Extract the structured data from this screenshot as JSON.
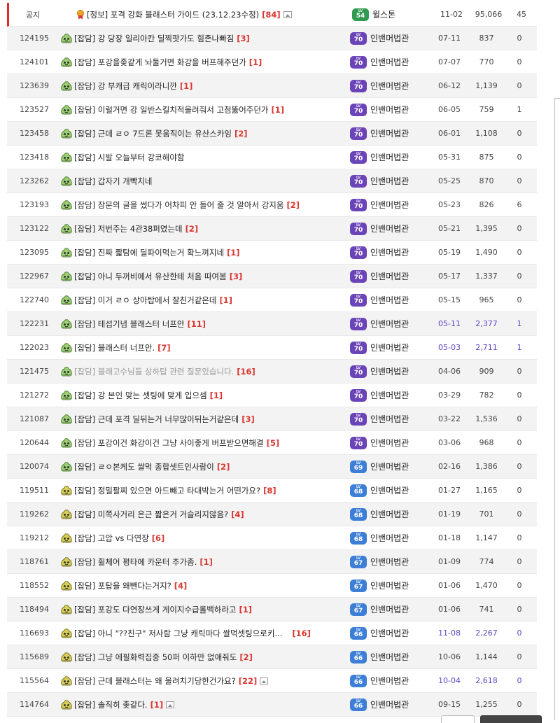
{
  "notice": {
    "label": "공지",
    "title": "[정보] 포격 강화 블래스터 가이드 (23.12.23수정)",
    "comments": "[84]",
    "has_image": true,
    "writer_level": "54",
    "writer": "윌스톤",
    "date": "11-02",
    "views": "95,066",
    "recommends": "45"
  },
  "rows": [
    {
      "num": "124195",
      "title": "[잡담] 강 당장 일리아칸 딜찍팟가도 힘존나빠짐",
      "comments": "[3]",
      "level": "70",
      "rank": "green",
      "writer": "인밴머법관",
      "date": "07-11",
      "views": "837",
      "rec": "0"
    },
    {
      "num": "124101",
      "title": "[잡담] 포강을좆같게 놔둘거면 화강을 버프해주던가",
      "comments": "[1]",
      "level": "70",
      "rank": "green",
      "writer": "인밴머법관",
      "date": "07-07",
      "views": "770",
      "rec": "0"
    },
    {
      "num": "123639",
      "title": "[잡담] 강 부캐급 캐릭이라니깐",
      "comments": "[1]",
      "level": "70",
      "rank": "green",
      "writer": "인밴머법관",
      "date": "06-12",
      "views": "1,139",
      "rec": "0"
    },
    {
      "num": "123527",
      "title": "[잡담] 이럴거면 강 일반스킬치적올려줘서 고점뚫어주던가",
      "comments": "[1]",
      "level": "70",
      "rank": "green",
      "writer": "인밴머법관",
      "date": "06-05",
      "views": "759",
      "rec": "1"
    },
    {
      "num": "123458",
      "title": "[잡담] 근데 ㄹㅇ 7드론 못움직이는 유산스카잉",
      "comments": "[2]",
      "level": "70",
      "rank": "green",
      "writer": "인밴머법관",
      "date": "06-01",
      "views": "1,108",
      "rec": "0"
    },
    {
      "num": "123418",
      "title": "[잡담] 시발 오늘부터 강코해야함",
      "comments": "",
      "level": "70",
      "rank": "green",
      "writer": "인밴머법관",
      "date": "05-31",
      "views": "875",
      "rec": "0"
    },
    {
      "num": "123262",
      "title": "[잡담] 갑자기 개빡치네",
      "comments": "",
      "level": "70",
      "rank": "green",
      "writer": "인밴머법관",
      "date": "05-25",
      "views": "870",
      "rec": "0"
    },
    {
      "num": "123193",
      "title": "[잡담] 장문의 글을 썼다가 어차피 안 들어 줄 것 알아서 강지움",
      "comments": "[2]",
      "level": "70",
      "rank": "green",
      "writer": "인밴머법관",
      "date": "05-23",
      "views": "826",
      "rec": "6"
    },
    {
      "num": "123122",
      "title": "[잡담] 저번주는 4관38퍼였는데",
      "comments": "[2]",
      "level": "70",
      "rank": "green",
      "writer": "인밴머법관",
      "date": "05-21",
      "views": "1,395",
      "rec": "0"
    },
    {
      "num": "123095",
      "title": "[잡담] 진짜 짧탐에 딜파이먹는거 확느껴지네",
      "comments": "[1]",
      "level": "70",
      "rank": "green",
      "writer": "인밴머법관",
      "date": "05-19",
      "views": "1,490",
      "rec": "0"
    },
    {
      "num": "122967",
      "title": "[잡담] 아니 두꺼비에서 유산한테 처음 따여봄",
      "comments": "[3]",
      "level": "70",
      "rank": "green",
      "writer": "인밴머법관",
      "date": "05-17",
      "views": "1,337",
      "rec": "0"
    },
    {
      "num": "122740",
      "title": "[잡담] 이거 ㄹㅇ 상아탑에서 잘친거같은데",
      "comments": "[1]",
      "level": "70",
      "rank": "green",
      "writer": "인밴머법관",
      "date": "05-15",
      "views": "965",
      "rec": "0"
    },
    {
      "num": "122231",
      "title": "[잡담] 테섭기념 블래스터 너프안",
      "comments": "[11]",
      "level": "70",
      "rank": "green",
      "writer": "인밴머법관",
      "date": "05-11",
      "views": "2,377",
      "rec": "1",
      "hl": true
    },
    {
      "num": "122023",
      "title": "[잡담] 블래스터 너프안.",
      "comments": "[7]",
      "level": "70",
      "rank": "green",
      "writer": "인밴머법관",
      "date": "05-03",
      "views": "2,711",
      "rec": "1",
      "hl": true
    },
    {
      "num": "121475",
      "title": "[잡담] 블래고수님들 상하탑 관련 질문있습니다.",
      "comments": "[16]",
      "level": "70",
      "rank": "green",
      "writer": "인밴머법관",
      "date": "04-06",
      "views": "909",
      "rec": "0",
      "grey": true
    },
    {
      "num": "121272",
      "title": "[잡담] 강 본인 맞는 셋팅에 맞게 입으셈",
      "comments": "[1]",
      "level": "70",
      "rank": "green",
      "writer": "인밴머법관",
      "date": "03-29",
      "views": "782",
      "rec": "0"
    },
    {
      "num": "121087",
      "title": "[잡담] 근데 포격 딜뒤는거 너무많이뒤는거같은데",
      "comments": "[3]",
      "level": "70",
      "rank": "green",
      "writer": "인밴머법관",
      "date": "03-22",
      "views": "1,536",
      "rec": "0"
    },
    {
      "num": "120644",
      "title": "[잡담] 포강이건 화강이건 그냥 사이좋게 버프받으면해결",
      "comments": "[5]",
      "level": "70",
      "rank": "green",
      "writer": "인밴머법관",
      "date": "03-06",
      "views": "968",
      "rec": "0"
    },
    {
      "num": "120074",
      "title": "[잡담] ㄹㅇ본케도 쌀먹 종합셋트인사람이",
      "comments": "[2]",
      "level": "69",
      "rank": "green",
      "writer": "인밴머법관",
      "date": "02-16",
      "views": "1,386",
      "rec": "0"
    },
    {
      "num": "119511",
      "title": "[잡담] 정밀팔찌 있으면 아드빼고 타대박는거 어떤가요?",
      "comments": "[8]",
      "level": "68",
      "rank": "yellow",
      "writer": "인밴머법관",
      "date": "01-27",
      "views": "1,165",
      "rec": "0"
    },
    {
      "num": "119262",
      "title": "[잡담] 미쪽사거리 은근 짧은거 거슬리지않음?",
      "comments": "[4]",
      "level": "68",
      "rank": "yellow",
      "writer": "인밴머법관",
      "date": "01-19",
      "views": "701",
      "rec": "0"
    },
    {
      "num": "119212",
      "title": "[잡담] 고압 vs 다연장",
      "comments": "[6]",
      "level": "68",
      "rank": "yellow",
      "writer": "인밴머법관",
      "date": "01-18",
      "views": "1,147",
      "rec": "0"
    },
    {
      "num": "118761",
      "title": "[잡담] 휠체어 평타에 카운터 추가좀.",
      "comments": "[1]",
      "level": "67",
      "rank": "yellow",
      "writer": "인밴머법관",
      "date": "01-09",
      "views": "774",
      "rec": "0"
    },
    {
      "num": "118552",
      "title": "[잡담] 포탑을 왜뺀다는거지?",
      "comments": "[4]",
      "level": "67",
      "rank": "yellow",
      "writer": "인밴머법관",
      "date": "01-06",
      "views": "1,470",
      "rec": "0"
    },
    {
      "num": "118494",
      "title": "[잡담] 포강도 다연장쓰게 게이지수급롤백하라고",
      "comments": "[1]",
      "level": "67",
      "rank": "yellow",
      "writer": "인밴머법관",
      "date": "01-06",
      "views": "741",
      "rec": "0"
    },
    {
      "num": "116693",
      "title": "[잡담] 아니 \"??친구\" 저사람 그냥 캐릭마다 쌀먹셋팅으로키...",
      "comments": "[16]",
      "level": "66",
      "rank": "yellow",
      "writer": "인밴머법관",
      "date": "11-08",
      "views": "2,267",
      "rec": "0",
      "hl": true
    },
    {
      "num": "115689",
      "title": "[잡담] 그냥 에필화력집중 50퍼 이하만 없애줘도",
      "comments": "[2]",
      "level": "66",
      "rank": "yellow",
      "writer": "인밴머법관",
      "date": "10-06",
      "views": "1,144",
      "rec": "0"
    },
    {
      "num": "115564",
      "title": "[잡담] 근데 블래스터는 왜 올려치기당한건가요?",
      "comments": "[22]",
      "level": "66",
      "rank": "yellow",
      "writer": "인밴머법관",
      "date": "10-04",
      "views": "2,618",
      "rec": "0",
      "hl": true,
      "img": true
    },
    {
      "num": "114764",
      "title": "[잡담] 솔직히 좆같다.",
      "comments": "[1]",
      "level": "66",
      "rank": "yellow",
      "writer": "인밴머법관",
      "date": "09-15",
      "views": "1,255",
      "rec": "0",
      "img": true
    }
  ],
  "colors": {
    "notice_bar": "#e02a2a",
    "comment_count": "#d9362f",
    "highlight_text": "#5e44c4",
    "level_purple": "#6b45b8",
    "level_blue": "#3d7fd6",
    "level_green": "#2f9a50"
  },
  "icons": {
    "notice_medal": "medal-icon",
    "image_attachment": "image-icon",
    "rank_green": "green-slime-rank-icon",
    "rank_yellow": "yellow-slime-rank-icon"
  }
}
